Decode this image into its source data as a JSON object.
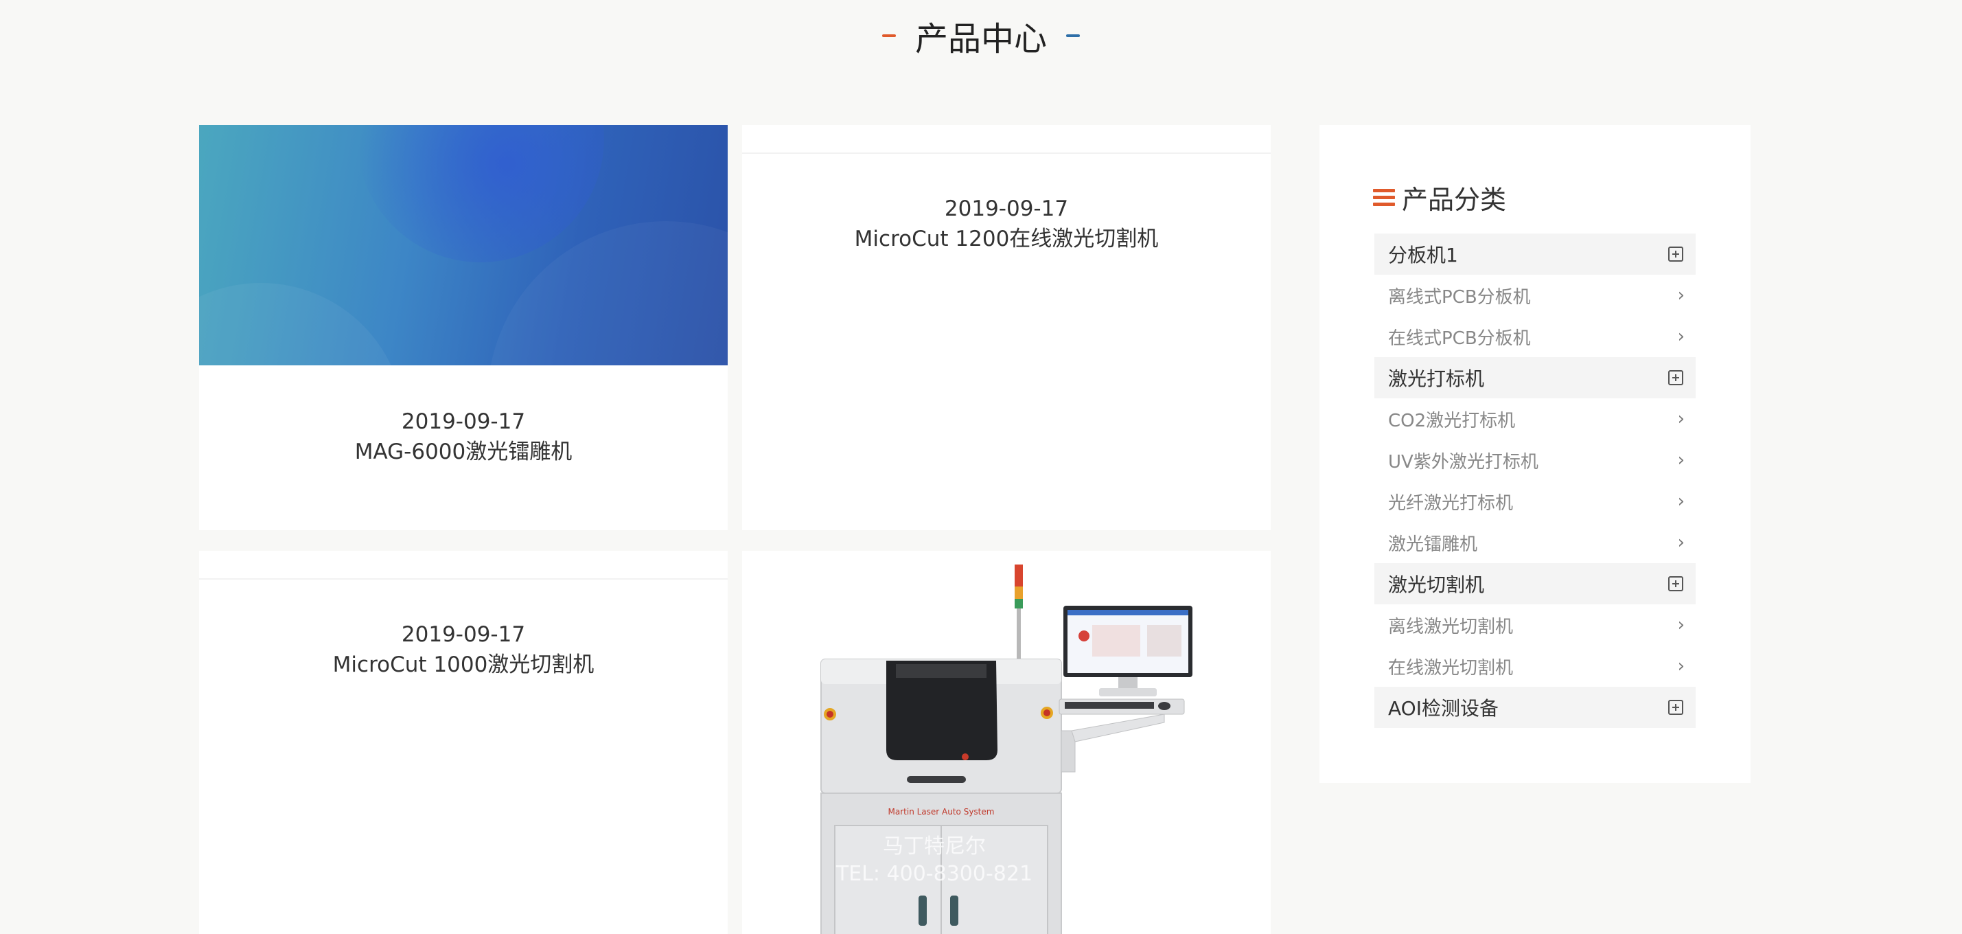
{
  "page": {
    "title": "产品中心"
  },
  "products": [
    {
      "date": "2019-09-17",
      "name": "MAG-6000激光镭雕机"
    },
    {
      "date": "2019-09-17",
      "name": "MicroCut 1200在线激光切割机"
    },
    {
      "date": "2019-09-17",
      "name": "MicroCut 1000激光切割机"
    }
  ],
  "machine_image": {
    "label": "Martin Laser Auto System",
    "watermark_line1": "马丁特尼尔",
    "watermark_line2": "TEL: 400-8300-821"
  },
  "sidebar": {
    "title": "产品分类",
    "groups": [
      {
        "label": "分板机1",
        "items": [
          "离线式PCB分板机",
          "在线式PCB分板机"
        ]
      },
      {
        "label": "激光打标机",
        "items": [
          "CO2激光打标机",
          "UV紫外激光打标机",
          "光纤激光打标机",
          "激光镭雕机"
        ]
      },
      {
        "label": "激光切割机",
        "items": [
          "离线激光切割机",
          "在线激光切割机"
        ]
      },
      {
        "label": "AOI检测设备",
        "items": []
      }
    ]
  },
  "colors": {
    "accent_orange": "#e05a2b",
    "accent_blue": "#2e6fa8",
    "background": "#f8f8f6"
  }
}
